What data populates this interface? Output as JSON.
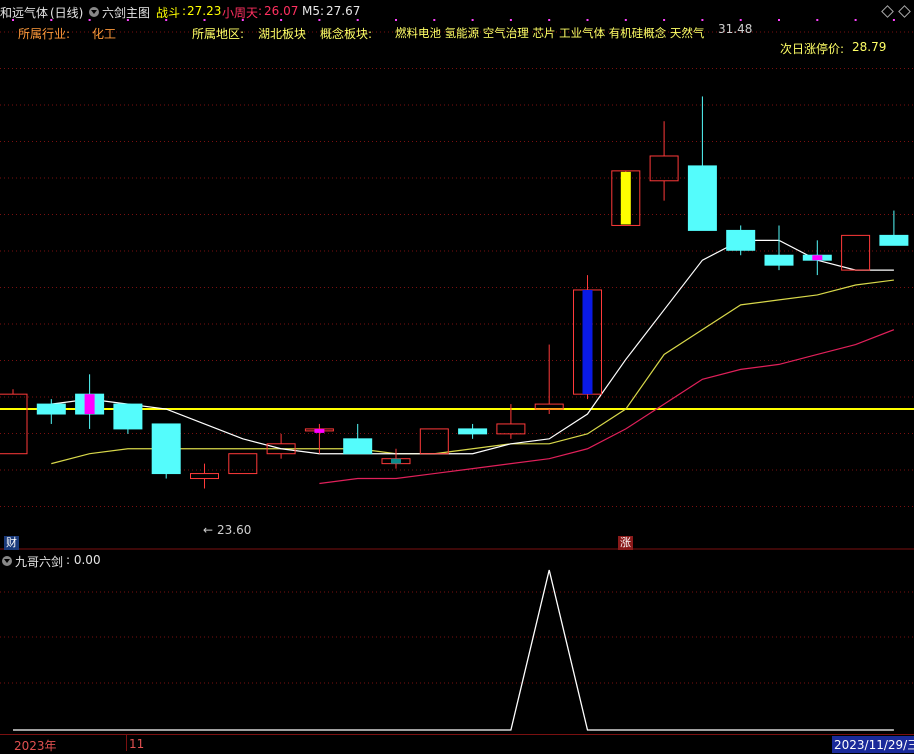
{
  "header": {
    "stock_name": "和远气体",
    "period": "(日线)",
    "indicator_name": "六剑主图",
    "zhandou_label": "战斗",
    "zhandou_value": "27.23",
    "xiaozhoutian_label": "小周天",
    "xiaozhoutian_value": "26.07",
    "m5_label": "M5",
    "m5_value": "27.67"
  },
  "info": {
    "industry_label": "所属行业:",
    "industry_value": "化工",
    "region_label": "所属地区:",
    "region_value": "湖北板块",
    "concept_label": "概念板块:",
    "concept_value": "燃料电池 氢能源 空气治理 芯片 工业气体 有机硅概念 天然气",
    "limit_up_label": "次日涨停价:",
    "limit_up_value": "28.79"
  },
  "annotations": {
    "high_price": "31.48",
    "low_price": "23.60",
    "low_arrow": "←",
    "cai_badge": "财",
    "zhang_badge": "涨"
  },
  "sub_panel": {
    "name": "九哥六剑",
    "value": ": 0.00"
  },
  "footer": {
    "year": "2023年",
    "month": "11",
    "date": "2023/11/29/三"
  },
  "colors": {
    "up": "#ff3a3a",
    "down": "#54fcfc",
    "yellow_line": "#ffff00",
    "ma_white": "#ffffff",
    "ma_yellow": "#d8d84a",
    "ma_pink": "#e0205a",
    "grid": "#7a1010"
  },
  "chart_data": {
    "type": "candlestick",
    "price_range": [
      22.4,
      33.0
    ],
    "reference_line": 25.2,
    "candles": [
      {
        "o": 24.3,
        "h": 25.6,
        "l": 24.3,
        "c": 25.5,
        "fill": "none"
      },
      {
        "o": 25.3,
        "h": 25.4,
        "l": 24.9,
        "c": 25.1,
        "fill": "down"
      },
      {
        "o": 25.5,
        "h": 25.9,
        "l": 24.8,
        "c": 25.1,
        "fill": "down",
        "mark": "magenta"
      },
      {
        "o": 25.3,
        "h": 25.3,
        "l": 24.7,
        "c": 24.8,
        "fill": "down"
      },
      {
        "o": 24.9,
        "h": 24.9,
        "l": 23.8,
        "c": 23.9,
        "fill": "down"
      },
      {
        "o": 23.8,
        "h": 24.1,
        "l": 23.6,
        "c": 23.9,
        "fill": "none"
      },
      {
        "o": 23.9,
        "h": 24.3,
        "l": 23.9,
        "c": 24.3,
        "fill": "none"
      },
      {
        "o": 24.3,
        "h": 24.7,
        "l": 24.2,
        "c": 24.5,
        "fill": "none"
      },
      {
        "o": 24.8,
        "h": 24.9,
        "l": 24.3,
        "c": 24.8,
        "fill": "none",
        "mark": "magenta"
      },
      {
        "o": 24.6,
        "h": 24.9,
        "l": 24.3,
        "c": 24.3,
        "fill": "down"
      },
      {
        "o": 24.1,
        "h": 24.4,
        "l": 24.0,
        "c": 24.2,
        "fill": "none",
        "mark": "teal"
      },
      {
        "o": 24.3,
        "h": 24.8,
        "l": 24.3,
        "c": 24.8,
        "fill": "none"
      },
      {
        "o": 24.8,
        "h": 24.9,
        "l": 24.6,
        "c": 24.7,
        "fill": "down"
      },
      {
        "o": 24.7,
        "h": 25.3,
        "l": 24.6,
        "c": 24.9,
        "fill": "none"
      },
      {
        "o": 25.2,
        "h": 26.5,
        "l": 25.1,
        "c": 25.3,
        "fill": "none"
      },
      {
        "o": 25.5,
        "h": 27.9,
        "l": 25.4,
        "c": 27.6,
        "fill": "blue"
      },
      {
        "o": 28.9,
        "h": 29.6,
        "l": 28.9,
        "c": 30.0,
        "fill": "yellow"
      },
      {
        "o": 29.8,
        "h": 31.0,
        "l": 29.4,
        "c": 30.3,
        "fill": "none"
      },
      {
        "o": 30.1,
        "h": 31.5,
        "l": 28.8,
        "c": 28.8,
        "fill": "down"
      },
      {
        "o": 28.8,
        "h": 28.9,
        "l": 28.3,
        "c": 28.4,
        "fill": "down"
      },
      {
        "o": 28.3,
        "h": 28.9,
        "l": 28.0,
        "c": 28.1,
        "fill": "down"
      },
      {
        "o": 28.3,
        "h": 28.6,
        "l": 27.9,
        "c": 28.2,
        "fill": "down",
        "mark": "magenta"
      },
      {
        "o": 28.0,
        "h": 28.7,
        "l": 28.0,
        "c": 28.7,
        "fill": "none"
      },
      {
        "o": 28.7,
        "h": 29.2,
        "l": 28.5,
        "c": 28.5,
        "fill": "down"
      }
    ],
    "ma_white": [
      null,
      25.3,
      25.4,
      25.3,
      25.2,
      24.9,
      24.6,
      24.4,
      24.3,
      24.3,
      24.3,
      24.3,
      24.3,
      24.5,
      24.6,
      25.1,
      26.2,
      27.2,
      28.2,
      28.6,
      28.6,
      28.2,
      28.0,
      28.0
    ],
    "ma_yellow": [
      null,
      24.1,
      24.3,
      24.4,
      24.4,
      24.4,
      24.4,
      24.4,
      24.4,
      24.4,
      24.3,
      24.3,
      24.4,
      24.5,
      24.5,
      24.7,
      25.2,
      26.3,
      26.8,
      27.3,
      27.4,
      27.5,
      27.7,
      27.8
    ],
    "ma_pink": [
      null,
      null,
      null,
      null,
      null,
      null,
      null,
      null,
      23.7,
      23.8,
      23.8,
      23.9,
      24.0,
      24.1,
      24.2,
      24.4,
      24.8,
      25.3,
      25.8,
      26.0,
      26.1,
      26.3,
      26.5,
      26.8
    ],
    "sub_indicator": [
      0,
      0,
      0,
      0,
      0,
      0,
      0,
      0,
      0,
      0,
      0,
      0,
      0,
      0,
      1,
      0,
      0,
      0,
      0,
      0,
      0,
      0,
      0,
      0
    ]
  }
}
